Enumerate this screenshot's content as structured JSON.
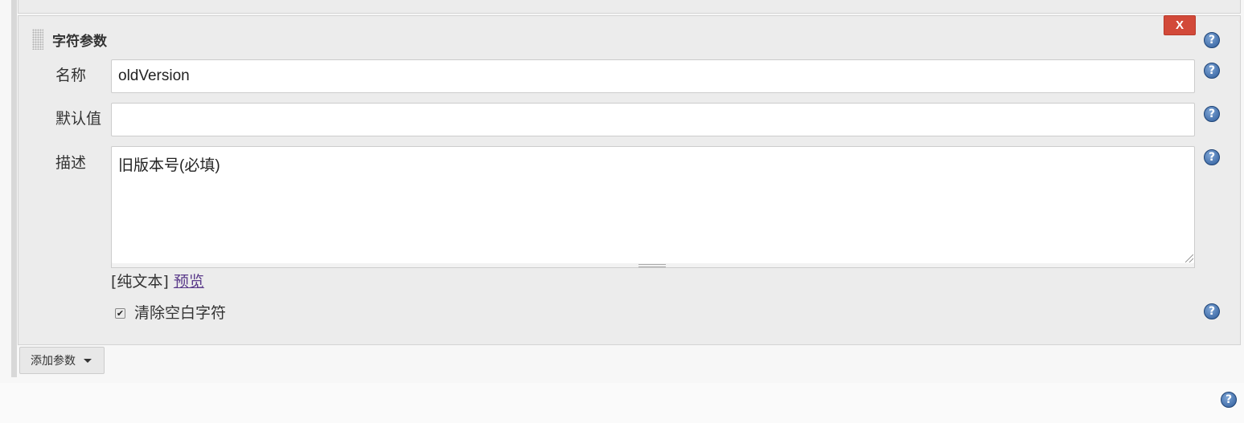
{
  "param": {
    "title": "字符参数",
    "delete_label": "X",
    "fields": [
      {
        "label": "名称",
        "value": "oldVersion",
        "placeholder": ""
      },
      {
        "label": "默认值",
        "value": "",
        "placeholder": ""
      }
    ],
    "description": {
      "label": "描述",
      "value": "旧版本号(必填)"
    },
    "markup": {
      "plain_text": "[纯文本]",
      "preview": "预览"
    },
    "trim": {
      "label": "清除空白字符",
      "checked": true
    }
  },
  "add_param_label": "添加参数",
  "icons": {
    "help": "help-icon",
    "grip": "drag-handle-icon",
    "caret": "caret-down-icon"
  },
  "colors": {
    "delete_bg": "#d24939",
    "help_bg": "#2d5b9a",
    "link": "#5a3a8a"
  }
}
